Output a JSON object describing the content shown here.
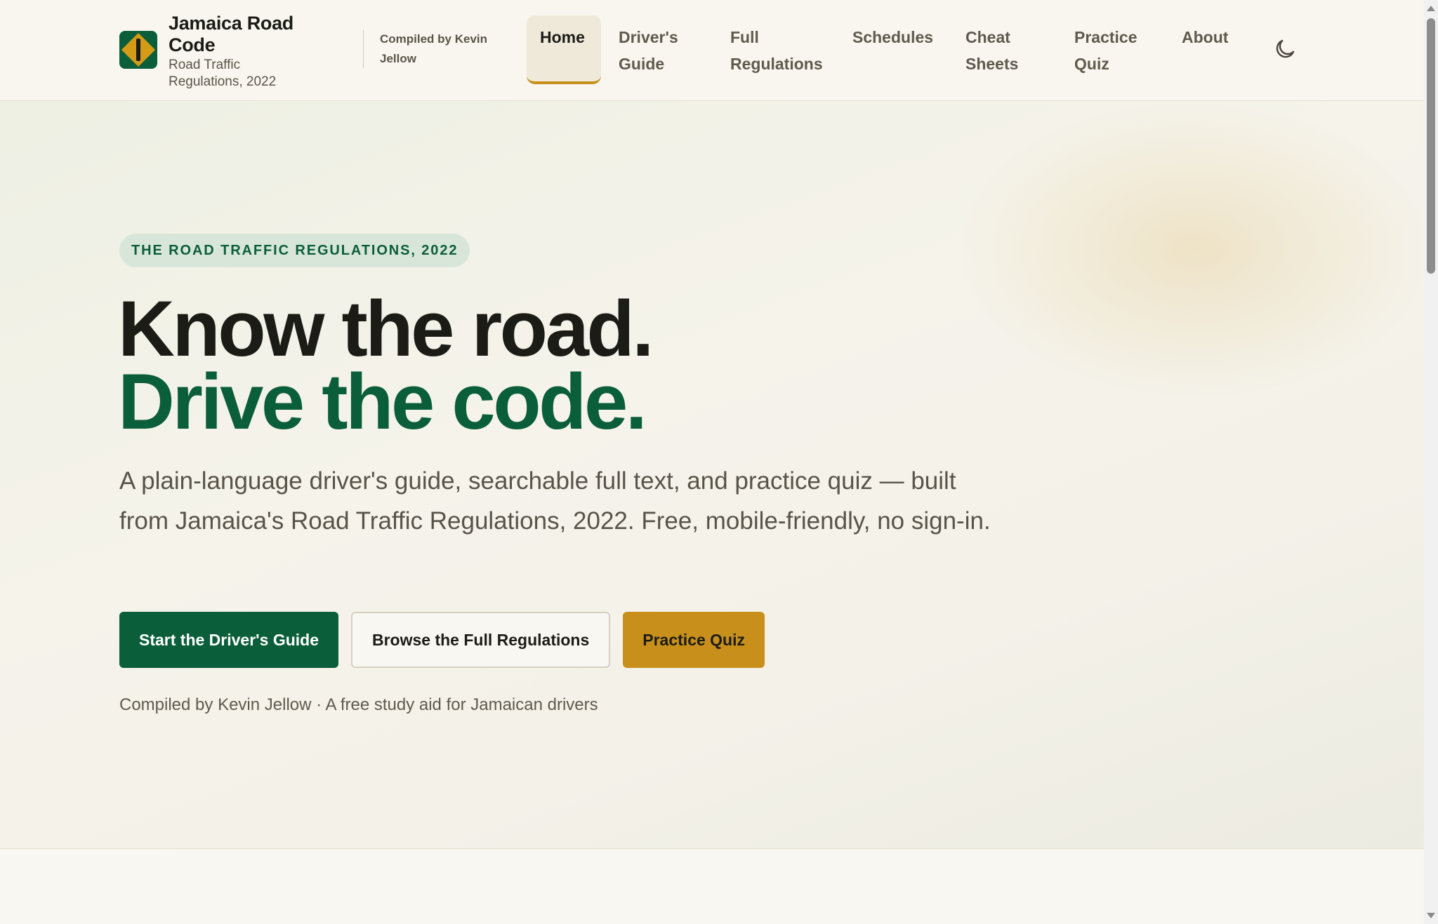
{
  "brand": {
    "title": "Jamaica Road Code",
    "subtitle": "Road Traffic Regulations, 2022",
    "logo_icon": "road-sign-diamond-icon",
    "compiled_by": "Compiled by Kevin Jellow"
  },
  "nav": {
    "items": [
      {
        "label": "Home",
        "active": true
      },
      {
        "label": "Driver's Guide",
        "active": false
      },
      {
        "label": "Full Regulations",
        "active": false
      },
      {
        "label": "Schedules",
        "active": false
      },
      {
        "label": "Cheat Sheets",
        "active": false
      },
      {
        "label": "Practice Quiz",
        "active": false
      },
      {
        "label": "About",
        "active": false
      }
    ],
    "theme_toggle_icon": "moon-icon"
  },
  "hero": {
    "eyebrow": "THE ROAD TRAFFIC REGULATIONS, 2022",
    "headline_line1": "Know the road.",
    "headline_line2": "Drive the code.",
    "lede": "A plain-language driver's guide, searchable full text, and practice quiz — built from Jamaica's Road Traffic Regulations, 2022. Free, mobile-friendly, no sign-in.",
    "buttons": {
      "primary": "Start the Driver's Guide",
      "secondary": "Browse the Full Regulations",
      "tertiary": "Practice Quiz"
    },
    "credit": "Compiled by Kevin Jellow · A free study aid for Jamaican drivers"
  },
  "colors": {
    "brand_green": "#0b5e3a",
    "brand_gold": "#c8901b",
    "background": "#f7f4ec",
    "ink": "#1c1c17"
  }
}
